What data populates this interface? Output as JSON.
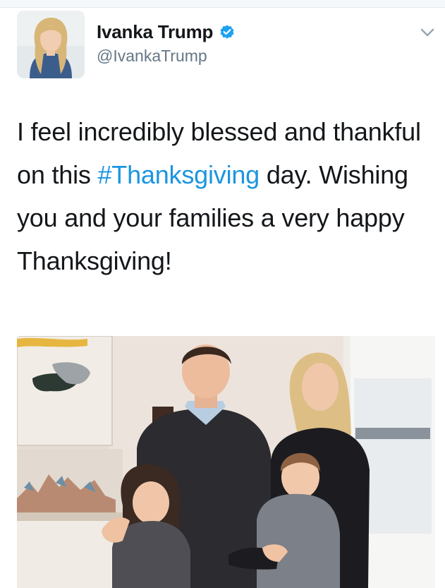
{
  "author": {
    "name": "Ivanka Trump",
    "handle": "@IvankaTrump",
    "verified": true
  },
  "tweet": {
    "text_before_hashtag": "I feel incredibly blessed and thankful on this ",
    "hashtag": "#Thanksgiving",
    "text_after_hashtag": " day. Wishing you and your families a very happy Thanksgiving!"
  },
  "colors": {
    "hashtag": "#1b95e0",
    "verified_badge": "#1da1f2",
    "secondary_text": "#657786"
  },
  "icons": {
    "verified": "verified-badge-icon",
    "menu": "chevron-down-icon"
  }
}
